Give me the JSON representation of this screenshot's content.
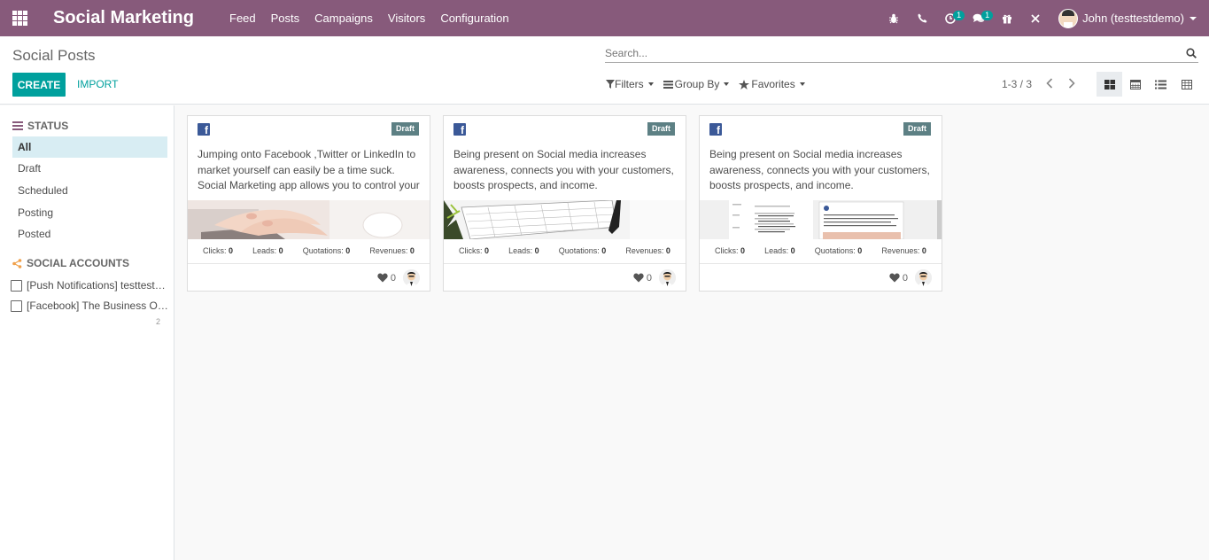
{
  "navbar": {
    "brand": "Social Marketing",
    "menu": [
      "Feed",
      "Posts",
      "Campaigns",
      "Visitors",
      "Configuration"
    ],
    "activity_badge": "1",
    "messages_badge": "1",
    "user_name": "John (testtestdemo)"
  },
  "control": {
    "title": "Social Posts",
    "create_label": "CREATE",
    "import_label": "IMPORT",
    "search_placeholder": "Search...",
    "filters_label": "Filters",
    "groupby_label": "Group By",
    "favorites_label": "Favorites",
    "pager": "1-3 / 3"
  },
  "sidebar": {
    "status_header": "STATUS",
    "status_items": [
      "All",
      "Draft",
      "Scheduled",
      "Posting",
      "Posted"
    ],
    "accounts_header": "SOCIAL ACCOUNTS",
    "accounts": [
      "[Push Notifications] testtestdemo",
      "[Facebook] The Business Of Bu..."
    ],
    "count": "2"
  },
  "cards": [
    {
      "badge": "Draft",
      "message": "Jumping onto Facebook ,Twitter or LinkedIn to market yourself can easily be a time suck. Social Marketing app allows you to control your",
      "stats": {
        "clicks_label": "Clicks:",
        "clicks": "0",
        "leads_label": "Leads:",
        "leads": "0",
        "quotations_label": "Quotations:",
        "quotations": "0",
        "revenues_label": "Revenues:",
        "revenues": "0"
      },
      "likes": "0"
    },
    {
      "badge": "Draft",
      "message": "Being present on Social media increases awareness, connects you with your customers, boosts prospects, and income.",
      "stats": {
        "clicks_label": "Clicks:",
        "clicks": "0",
        "leads_label": "Leads:",
        "leads": "0",
        "quotations_label": "Quotations:",
        "quotations": "0",
        "revenues_label": "Revenues:",
        "revenues": "0"
      },
      "likes": "0"
    },
    {
      "badge": "Draft",
      "message": "Being present on Social media increases awareness, connects you with your customers, boosts prospects, and income.",
      "stats": {
        "clicks_label": "Clicks:",
        "clicks": "0",
        "leads_label": "Leads:",
        "leads": "0",
        "quotations_label": "Quotations:",
        "quotations": "0",
        "revenues_label": "Revenues:",
        "revenues": "0"
      },
      "likes": "0"
    }
  ],
  "colors": {
    "brand": "#875a7b",
    "accent": "#00a09d",
    "draft": "#5d8084",
    "facebook": "#3b5998"
  }
}
